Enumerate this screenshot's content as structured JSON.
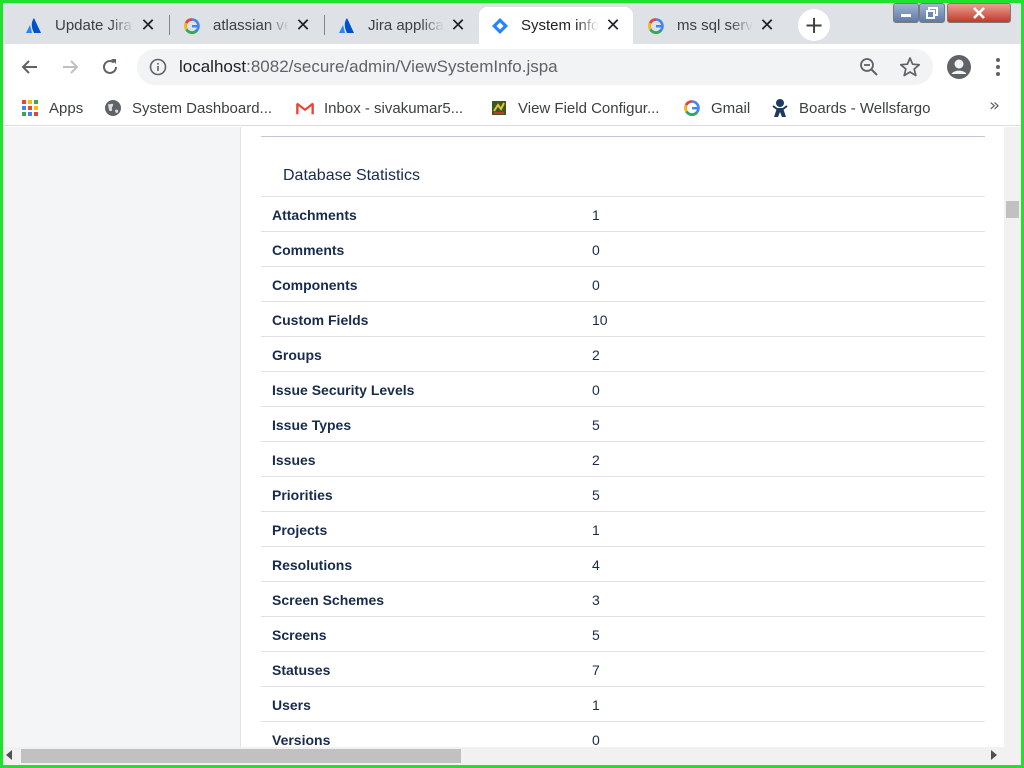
{
  "browser": {
    "tabs": [
      {
        "title": "Update Jira",
        "favicon": "atlassian-icon",
        "active": false
      },
      {
        "title": "atlassian ve",
        "favicon": "google-icon",
        "active": false
      },
      {
        "title": "Jira applica",
        "favicon": "atlassian-icon",
        "active": false
      },
      {
        "title": "System info",
        "favicon": "jira-icon",
        "active": true
      },
      {
        "title": "ms sql serv",
        "favicon": "google-icon",
        "active": false
      }
    ],
    "new_tab_label": "+",
    "close_glyph": "✕",
    "address": {
      "host": "localhost",
      "path": ":8082/secure/admin/ViewSystemInfo.jspa"
    },
    "bookmarks": [
      {
        "label": "Apps",
        "icon": "apps-grid-icon"
      },
      {
        "label": "System Dashboard...",
        "icon": "globe-icon"
      },
      {
        "label": "Inbox - sivakumar5...",
        "icon": "gmail-icon"
      },
      {
        "label": "View Field Configur...",
        "icon": "bookmark-app-icon"
      },
      {
        "label": "Gmail",
        "icon": "google-icon"
      },
      {
        "label": "Boards - Wellsfargo",
        "icon": "jenkins-icon"
      }
    ],
    "bookmarks_more": "»",
    "frame_color": "#22e02e"
  },
  "page": {
    "section_title": "Database Statistics",
    "stats": [
      {
        "label": "Attachments",
        "value": "1"
      },
      {
        "label": "Comments",
        "value": "0"
      },
      {
        "label": "Components",
        "value": "0"
      },
      {
        "label": "Custom Fields",
        "value": "10"
      },
      {
        "label": "Groups",
        "value": "2"
      },
      {
        "label": "Issue Security Levels",
        "value": "0"
      },
      {
        "label": "Issue Types",
        "value": "5"
      },
      {
        "label": "Issues",
        "value": "2"
      },
      {
        "label": "Priorities",
        "value": "5"
      },
      {
        "label": "Projects",
        "value": "1"
      },
      {
        "label": "Resolutions",
        "value": "4"
      },
      {
        "label": "Screen Schemes",
        "value": "3"
      },
      {
        "label": "Screens",
        "value": "5"
      },
      {
        "label": "Statuses",
        "value": "7"
      },
      {
        "label": "Users",
        "value": "1"
      },
      {
        "label": "Versions",
        "value": "0"
      }
    ]
  }
}
